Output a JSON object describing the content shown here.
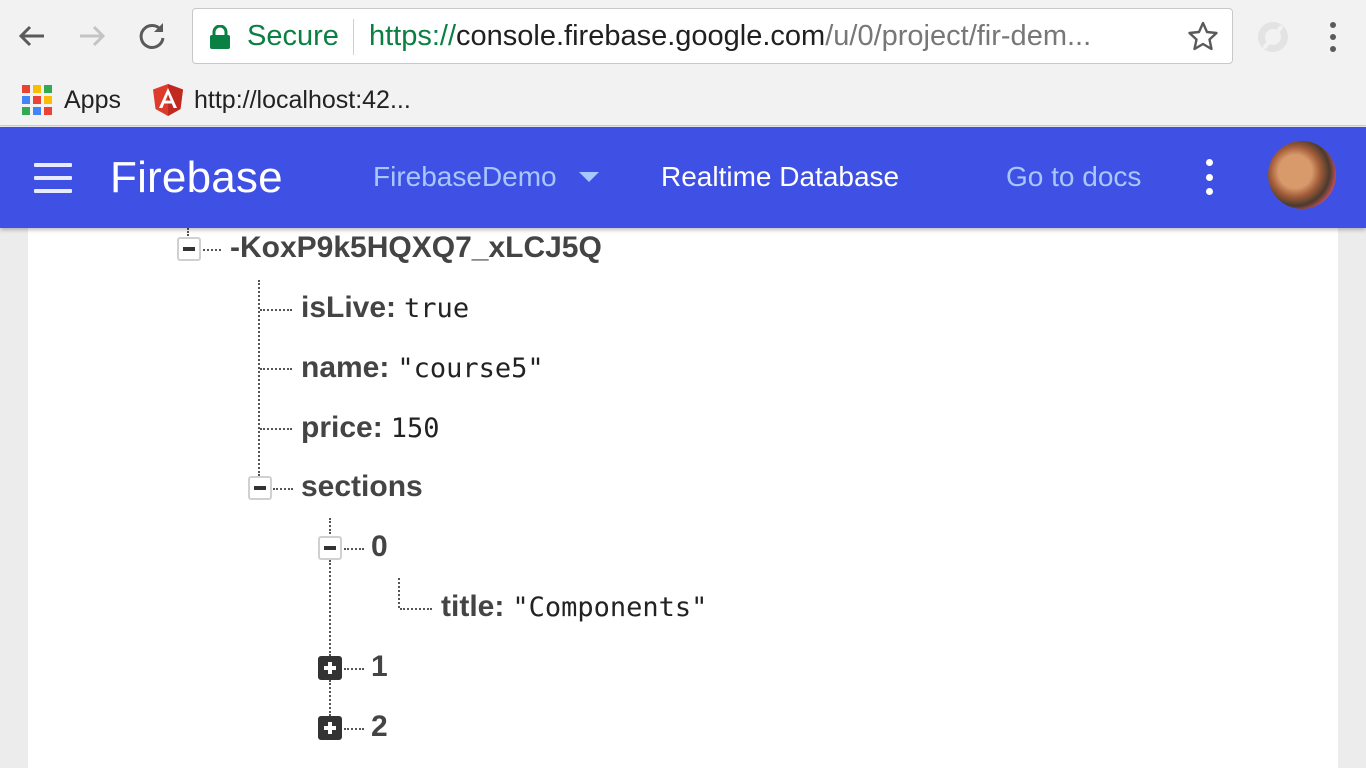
{
  "browser": {
    "secure_label": "Secure",
    "url_scheme": "https://",
    "url_host": "console.firebase.google.com",
    "url_path": "/u/0/project/fir-dem...",
    "bookmarks": [
      {
        "label": "Apps",
        "icon": "apps-grid-icon"
      },
      {
        "label": "http://localhost:42...",
        "icon": "angular-icon"
      }
    ]
  },
  "header": {
    "brand": "Firebase",
    "project": "FirebaseDemo",
    "section": "Realtime Database",
    "docs_link": "Go to docs"
  },
  "tree": {
    "root_key": "-KoxP9k5HQXQ7_xLCJ5Q",
    "fields": [
      {
        "key": "isLive:",
        "value": "true"
      },
      {
        "key": "name:",
        "value": "\"course5\""
      },
      {
        "key": "price:",
        "value": "150"
      }
    ],
    "sections_key": "sections",
    "sections": [
      {
        "key": "0",
        "expanded": true,
        "child_key": "title:",
        "child_value": "\"Components\""
      },
      {
        "key": "1",
        "expanded": false
      },
      {
        "key": "2",
        "expanded": false
      }
    ]
  },
  "colors": {
    "header_bg": "#3f51e5",
    "header_link": "#a7c7ff",
    "secure_green": "#0b8043"
  }
}
